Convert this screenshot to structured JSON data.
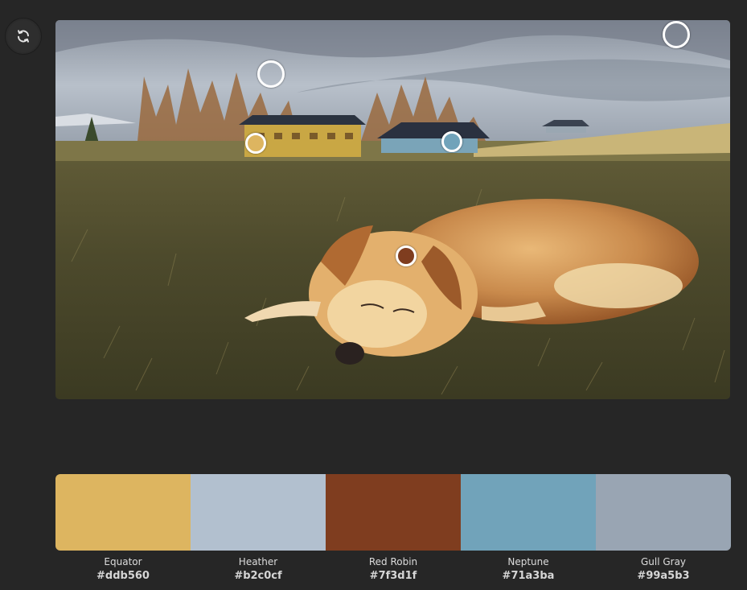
{
  "toolbar": {
    "refresh_icon": "refresh-icon"
  },
  "image": {
    "description_icon": "photo-dog-in-field"
  },
  "pickers": [
    {
      "color": "#ddb560",
      "style": "filled"
    },
    {
      "color": "#b2c0cf",
      "style": "hollow"
    },
    {
      "color": "#7f3d1f",
      "style": "filled"
    },
    {
      "color": "#71a3ba",
      "style": "filled"
    },
    {
      "color": "#99a5b3",
      "style": "hollow"
    }
  ],
  "palette": [
    {
      "name": "Equator",
      "hex": "#ddb560"
    },
    {
      "name": "Heather",
      "hex": "#b2c0cf"
    },
    {
      "name": "Red Robin",
      "hex": "#7f3d1f"
    },
    {
      "name": "Neptune",
      "hex": "#71a3ba"
    },
    {
      "name": "Gull Gray",
      "hex": "#99a5b3"
    }
  ]
}
